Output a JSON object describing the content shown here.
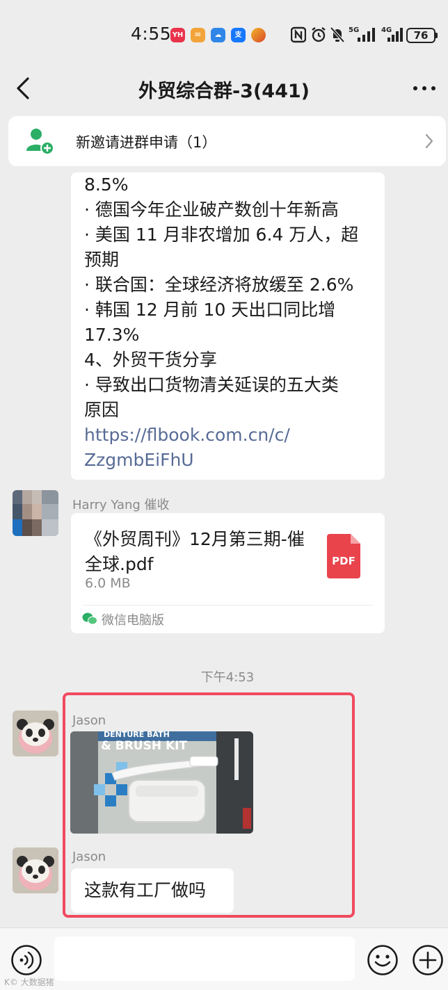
{
  "status_bar": {
    "time": "4:55",
    "apps": [
      {
        "icon": "yh-app-icon",
        "label": "YH",
        "color": "#e8334a"
      },
      {
        "icon": "mail-app-icon",
        "label": "✉",
        "color": "#f2a43a"
      },
      {
        "icon": "cloud-app-icon",
        "label": "☁",
        "color": "#2f86e8"
      },
      {
        "icon": "alipay-app-icon",
        "label": "支",
        "color": "#1677ff"
      },
      {
        "icon": "game-app-icon",
        "label": "",
        "color": "#d9472b"
      }
    ],
    "signal_5g": "5G",
    "signal_4g": "4G",
    "battery": "76"
  },
  "nav": {
    "title": "外贸综合群-3(441)"
  },
  "invite_banner": {
    "text": "新邀请进群申请（1）"
  },
  "news_message": {
    "lines": [
      "8.5%",
      "· 德国今年企业破产数创十年新高",
      "· 美国 11 月非农增加 6.4 万人，超",
      "预期",
      "· 联合国：全球经济将放缓至 2.6%",
      "· 韩国 12 月前 10 天出口同比增",
      "17.3%",
      "4、外贸干货分享",
      "· 导致出口货物清关延误的五大类",
      "原因"
    ],
    "link_lines": [
      "https://flbook.com.cn/c/",
      "ZzgmbEiFhU"
    ]
  },
  "file_message": {
    "sender": "Harry Yang 催收",
    "title": "《外贸周刊》12月第三期-催全球.pdf",
    "size": "6.0 MB",
    "file_type": "PDF",
    "source": "微信电脑版"
  },
  "timestamp": "下午4:53",
  "photo_message": {
    "sender": "Jason",
    "photo_text_line1": "DENTURE BATH",
    "photo_text_line2": "& BRUSH KIT"
  },
  "text_message": {
    "sender": "Jason",
    "text": "这款有工厂做吗"
  },
  "input_bar": {
    "placeholder": ""
  },
  "watermark": "K© 大数据猪"
}
